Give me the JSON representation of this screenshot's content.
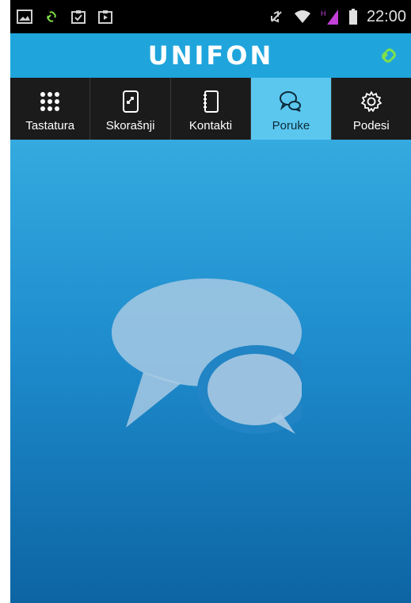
{
  "status_bar": {
    "time": "22:00",
    "left_icons": [
      "image-icon",
      "link-icon",
      "clipboard-check-icon",
      "clipboard-play-icon"
    ],
    "right_icons": [
      "mute-icon",
      "wifi-icon",
      "signal-icon",
      "battery-icon"
    ]
  },
  "header": {
    "logo": "UNIFON",
    "link_status_color": "#7fe04a"
  },
  "tabs": [
    {
      "label": "Tastatura",
      "icon": "dialpad-icon",
      "active": false
    },
    {
      "label": "Skorašnji",
      "icon": "recent-calls-icon",
      "active": false
    },
    {
      "label": "Kontakti",
      "icon": "contacts-icon",
      "active": false
    },
    {
      "label": "Poruke",
      "icon": "messages-icon",
      "active": true
    },
    {
      "label": "Podesi",
      "icon": "settings-icon",
      "active": false
    }
  ],
  "main": {
    "empty_state_icon": "chat-bubbles-icon"
  },
  "colors": {
    "accent": "#1fa5dc",
    "active_tab": "#5bc7ef",
    "tab_bar": "#1b1b1b"
  }
}
